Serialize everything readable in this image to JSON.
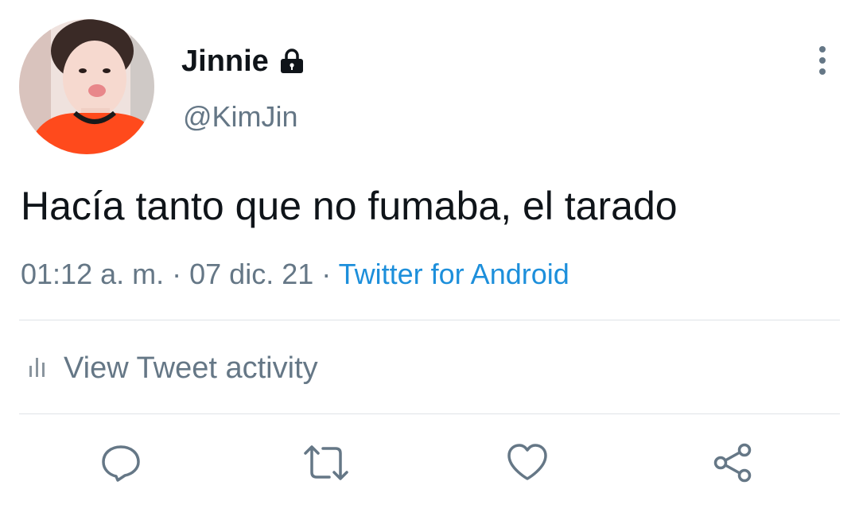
{
  "user": {
    "display_name": "Jinnie",
    "handle": "@KimJin",
    "protected_icon": "lock-icon",
    "avatar": "profile-photo"
  },
  "tweet": {
    "text": "Hacía tanto que no fumaba, el tarado",
    "time": "01:12 a. m.",
    "sep1": "·",
    "date": "07 dic. 21",
    "sep2": "·",
    "source": "Twitter for Android"
  },
  "activity": {
    "label": "View Tweet activity",
    "icon": "bar-chart-icon"
  },
  "actions": {
    "icons": [
      "reply-icon",
      "retweet-icon",
      "like-icon",
      "share-icon"
    ]
  },
  "menu_icon": "more-vertical-icon",
  "colors": {
    "primary_text": "#0f1419",
    "secondary_text": "#657786",
    "link": "#1d8fdb",
    "divider": "#dfe3e7"
  }
}
